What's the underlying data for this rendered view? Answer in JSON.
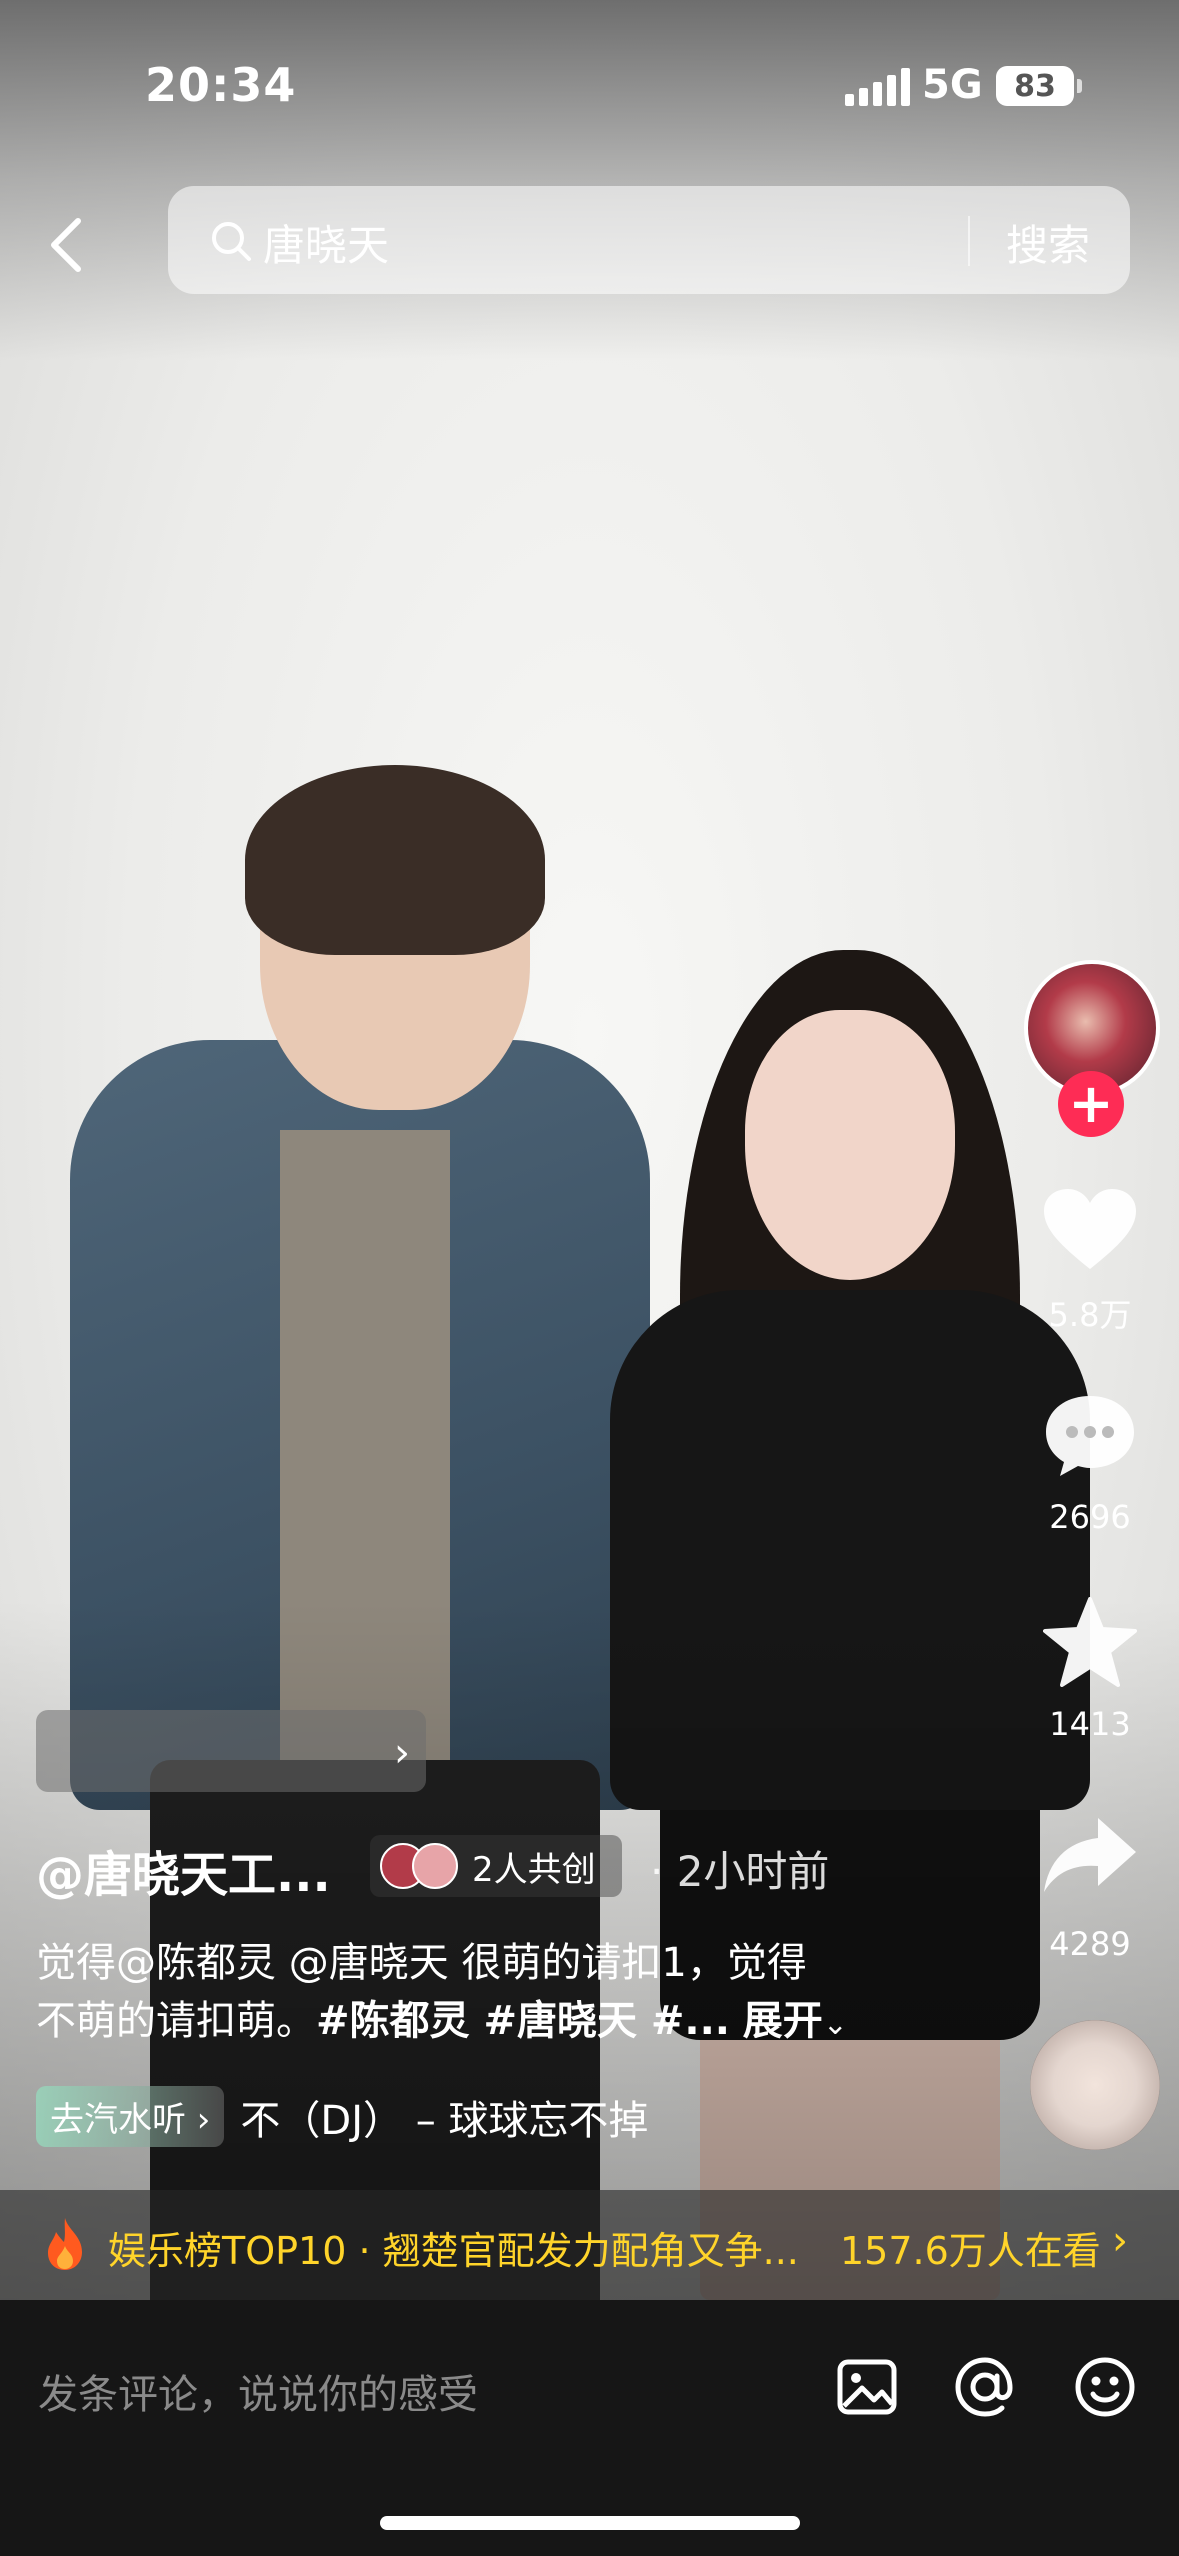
{
  "status_bar": {
    "time": "20:34",
    "network": "5G",
    "battery": "83"
  },
  "search": {
    "query": "唐晓天",
    "button_label": "搜索"
  },
  "rail": {
    "likes": "5.8万",
    "comments": "2696",
    "favorites": "1413",
    "shares": "4289"
  },
  "video": {
    "author": "@唐晓天工...",
    "cocreate_label": "2人共创",
    "time_ago": "· 2小时前",
    "description_line1": "觉得@陈都灵 @唐晓天 很萌的请扣1，觉得",
    "description_line2_prefix": "不萌的请扣萌。",
    "description_tags": "#陈都灵 #唐晓天 #...",
    "expand_label": "展开",
    "music_tag": "去汽水听 ›",
    "music_title": "不（DJ） – 球球忘不掉"
  },
  "hot_banner": {
    "text": "娱乐榜TOP10 · 翘楚官配发力配角又争...",
    "viewers": "157.6万人在看",
    "color": "#ffd42a"
  },
  "comment_bar": {
    "placeholder": "发条评论，说说你的感受"
  },
  "colors": {
    "follow": "#fe2c55",
    "comment_bg": "#161616"
  }
}
